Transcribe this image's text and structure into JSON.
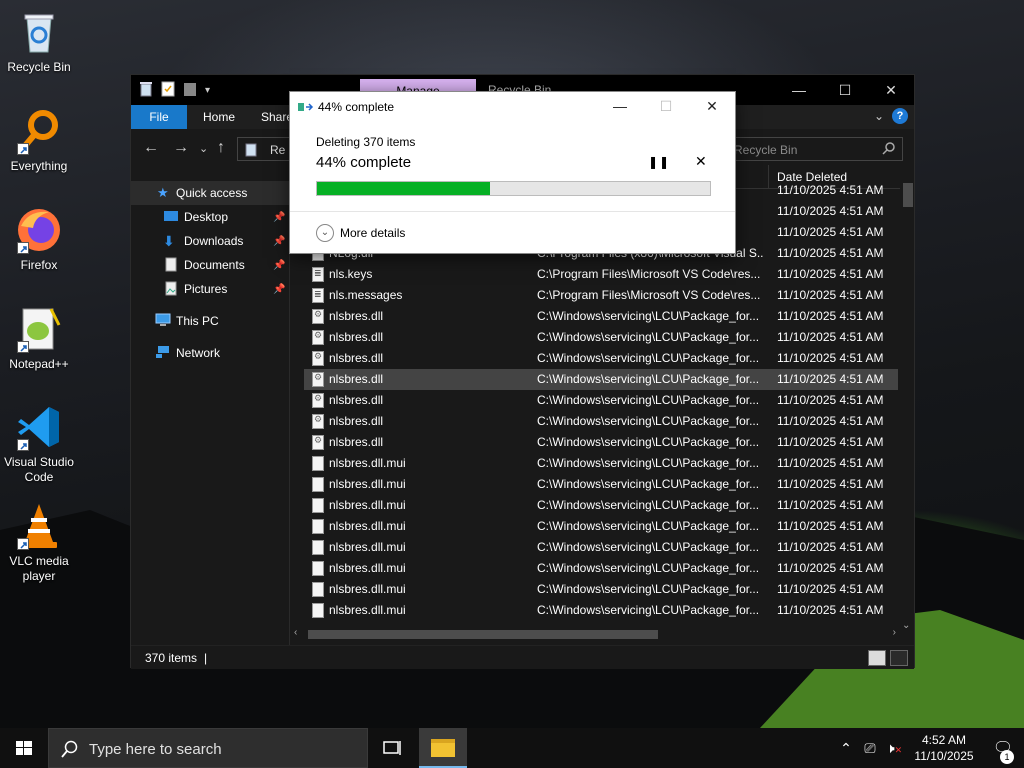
{
  "desktop": {
    "icons": [
      {
        "label": "Recycle Bin",
        "icon": "recycle-bin-icon"
      },
      {
        "label": "Everything",
        "icon": "everything-search-icon"
      },
      {
        "label": "Firefox",
        "icon": "firefox-icon"
      },
      {
        "label": "Notepad++",
        "icon": "notepad-plus-plus-icon"
      },
      {
        "label": "Visual Studio Code",
        "icon": "vscode-icon"
      },
      {
        "label": "VLC media player",
        "icon": "vlc-icon"
      }
    ]
  },
  "explorer": {
    "manage_tab": "Manage",
    "title": "Recycle Bin",
    "ribbon_tabs": [
      "File",
      "Home",
      "Share"
    ],
    "address": "Re",
    "search_placeholder": "h Recycle Bin",
    "column_date": "Date Deleted",
    "nav": {
      "quick_access": "Quick access",
      "desktop": "Desktop",
      "downloads": "Downloads",
      "documents": "Documents",
      "pictures": "Pictures",
      "this_pc": "This PC",
      "network": "Network"
    },
    "rows": [
      {
        "name": "",
        "location": "",
        "date": "11/10/2025 4:51 AM",
        "type": "none"
      },
      {
        "name": "",
        "location": "l0\\...",
        "date": "11/10/2025 4:51 AM",
        "type": "none"
      },
      {
        "name": "",
        "location": "l0\\...",
        "date": "11/10/2025 4:51 AM",
        "type": "none"
      },
      {
        "name": "NLog.dll",
        "location": "C:\\Program Files (x86)\\Microsoft Visual S...",
        "date": "11/10/2025 4:51 AM",
        "type": "dll"
      },
      {
        "name": "nls.keys",
        "location": "C:\\Program Files\\Microsoft VS Code\\res...",
        "date": "11/10/2025 4:51 AM",
        "type": "keys"
      },
      {
        "name": "nls.messages",
        "location": "C:\\Program Files\\Microsoft VS Code\\res...",
        "date": "11/10/2025 4:51 AM",
        "type": "keys"
      },
      {
        "name": "nlsbres.dll",
        "location": "C:\\Windows\\servicing\\LCU\\Package_for...",
        "date": "11/10/2025 4:51 AM",
        "type": "dll"
      },
      {
        "name": "nlsbres.dll",
        "location": "C:\\Windows\\servicing\\LCU\\Package_for...",
        "date": "11/10/2025 4:51 AM",
        "type": "dll"
      },
      {
        "name": "nlsbres.dll",
        "location": "C:\\Windows\\servicing\\LCU\\Package_for...",
        "date": "11/10/2025 4:51 AM",
        "type": "dll"
      },
      {
        "name": "nlsbres.dll",
        "location": "C:\\Windows\\servicing\\LCU\\Package_for...",
        "date": "11/10/2025 4:51 AM",
        "type": "dll",
        "selected": true
      },
      {
        "name": "nlsbres.dll",
        "location": "C:\\Windows\\servicing\\LCU\\Package_for...",
        "date": "11/10/2025 4:51 AM",
        "type": "dll"
      },
      {
        "name": "nlsbres.dll",
        "location": "C:\\Windows\\servicing\\LCU\\Package_for...",
        "date": "11/10/2025 4:51 AM",
        "type": "dll"
      },
      {
        "name": "nlsbres.dll",
        "location": "C:\\Windows\\servicing\\LCU\\Package_for...",
        "date": "11/10/2025 4:51 AM",
        "type": "dll"
      },
      {
        "name": "nlsbres.dll.mui",
        "location": "C:\\Windows\\servicing\\LCU\\Package_for...",
        "date": "11/10/2025 4:51 AM",
        "type": "file"
      },
      {
        "name": "nlsbres.dll.mui",
        "location": "C:\\Windows\\servicing\\LCU\\Package_for...",
        "date": "11/10/2025 4:51 AM",
        "type": "file"
      },
      {
        "name": "nlsbres.dll.mui",
        "location": "C:\\Windows\\servicing\\LCU\\Package_for...",
        "date": "11/10/2025 4:51 AM",
        "type": "file"
      },
      {
        "name": "nlsbres.dll.mui",
        "location": "C:\\Windows\\servicing\\LCU\\Package_for...",
        "date": "11/10/2025 4:51 AM",
        "type": "file"
      },
      {
        "name": "nlsbres.dll.mui",
        "location": "C:\\Windows\\servicing\\LCU\\Package_for...",
        "date": "11/10/2025 4:51 AM",
        "type": "file"
      },
      {
        "name": "nlsbres.dll.mui",
        "location": "C:\\Windows\\servicing\\LCU\\Package_for...",
        "date": "11/10/2025 4:51 AM",
        "type": "file"
      },
      {
        "name": "nlsbres.dll.mui",
        "location": "C:\\Windows\\servicing\\LCU\\Package_for...",
        "date": "11/10/2025 4:51 AM",
        "type": "file"
      },
      {
        "name": "nlsbres.dll.mui",
        "location": "C:\\Windows\\servicing\\LCU\\Package_for...",
        "date": "11/10/2025 4:51 AM",
        "type": "file"
      }
    ],
    "status": "370 items",
    "status_sep": "|"
  },
  "progress": {
    "title": "44% complete",
    "subtitle": "Deleting 370 items",
    "big_text": "44% complete",
    "percent": 44,
    "pause_glyph": "❚❚",
    "cancel_glyph": "✕",
    "more_details": "More details",
    "fill_color": "#06b025"
  },
  "taskbar": {
    "search_placeholder": "Type here to search",
    "time": "4:52 AM",
    "date": "11/10/2025",
    "notification_count": "1"
  }
}
